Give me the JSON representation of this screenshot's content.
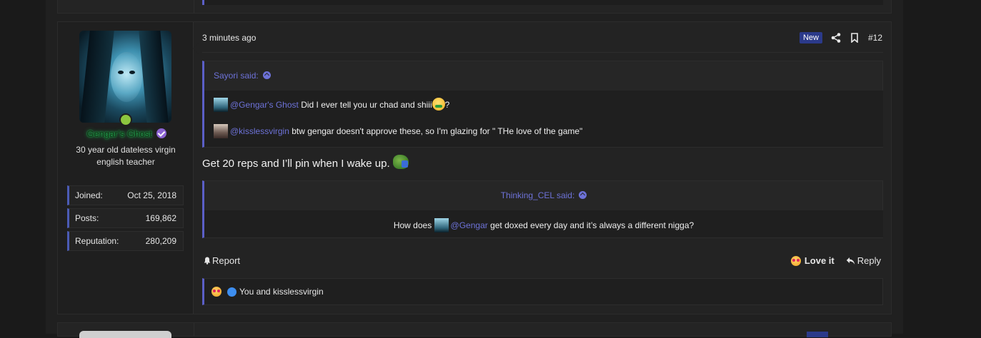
{
  "post": {
    "time": "3 minutes ago",
    "badge": "New",
    "number": "#12",
    "user": {
      "name": "Gengar’s Ghost",
      "title_line1": "30 year old dateless virgin",
      "title_line2": "english teacher",
      "stats": [
        {
          "label": "Joined:",
          "value": "Oct 25, 2018"
        },
        {
          "label": "Posts:",
          "value": "169,862"
        },
        {
          "label": "Reputation:",
          "value": "280,209"
        }
      ]
    },
    "quote1": {
      "attribution": "Sayori said:",
      "line1": {
        "mention": "@Gengar's Ghost",
        "text": " Did I ever tell you ur chad and shiii",
        "after": "?"
      },
      "line2": {
        "mention": "@kisslessvirgin",
        "text": " btw gengar doesn't approve these, so I'm glazing for \" THe love of the game\""
      }
    },
    "message": "Get 20 reps and I’ll pin when I wake up.",
    "quote2": {
      "attribution": "Thinking_CEL said:",
      "before": "How does ",
      "mention": "@Gengar",
      "after": " get doxed every day and it’s always a different nigga?"
    },
    "actions": {
      "report": "Report",
      "love": "Love it",
      "reply": "Reply"
    },
    "reactions_text": "You and kisslessvirgin",
    "colors": {
      "accent": "#5b5fc7",
      "mention": "#6d72d8",
      "username_glow": "#1fcf5a",
      "badge_bg": "#2b3a8a"
    },
    "icons": [
      "share-icon",
      "bookmark-icon",
      "bell-icon",
      "reply-icon",
      "verified-icon",
      "arrow-up-icon",
      "love-icon",
      "like-icon"
    ]
  }
}
